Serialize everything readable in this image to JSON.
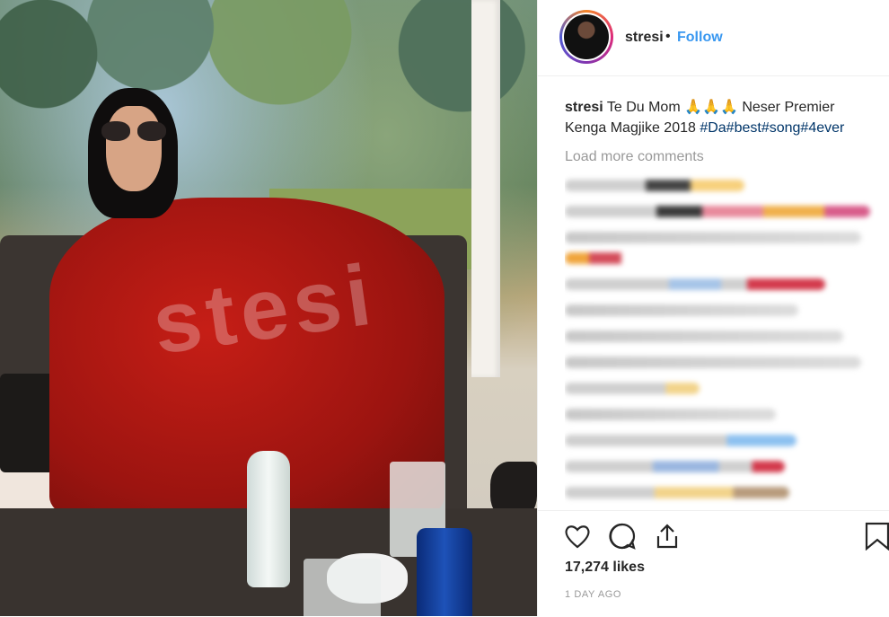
{
  "post": {
    "image_alt": "Woman in red dress sitting on wicker sofa",
    "watermark": "stesi"
  },
  "header": {
    "username": "stresi",
    "separator": "•",
    "follow_label": "Follow"
  },
  "caption": {
    "username": "stresi",
    "text_before": " Te Du Mom ",
    "emoji": "🙏🙏🙏",
    "text_after": " Neser Premier Kenga Magjike 2018 ",
    "hashtags": "#Da#best#song#4ever"
  },
  "comments": {
    "load_more_label": "Load more comments",
    "blurred_count": 13
  },
  "actions": {
    "like_icon": "heart-icon",
    "comment_icon": "comment-icon",
    "share_icon": "share-icon",
    "save_icon": "bookmark-icon",
    "likes": "17,274 likes",
    "time": "1 DAY AGO"
  },
  "colors": {
    "link_blue": "#3897f0",
    "hashtag": "#003569",
    "muted": "#999999"
  }
}
